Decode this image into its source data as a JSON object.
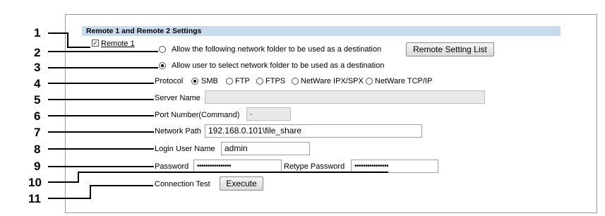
{
  "section": {
    "title": "Remote 1 and Remote 2 Settings"
  },
  "remote1": {
    "label": "Remote 1",
    "checked": true
  },
  "destination": {
    "option_following": "Allow the following network folder to be used as a destination",
    "option_user_select": "Allow user to select network folder to be used as a destination",
    "remote_setting_list_button": "Remote Setting List"
  },
  "protocol": {
    "label": "Protocol",
    "options": [
      "SMB",
      "FTP",
      "FTPS",
      "NetWare IPX/SPX",
      "NetWare TCP/IP"
    ],
    "selected": "SMB"
  },
  "server_name": {
    "label": "Server Name",
    "value": ""
  },
  "port": {
    "label": "Port Number(Command)",
    "value": "-"
  },
  "network_path": {
    "label": "Network Path",
    "value": "192.168.0.101\\file_share"
  },
  "login_user": {
    "label": "Login User Name",
    "value": "admin"
  },
  "password": {
    "label": "Password",
    "value": "••••••••••••••••",
    "retype_label": "Retype Password",
    "retype_value": "••••••••••••••••"
  },
  "connection_test": {
    "label": "Connection Test",
    "button": "Execute"
  },
  "callouts": [
    "1",
    "2",
    "3",
    "4",
    "5",
    "6",
    "7",
    "8",
    "9",
    "10",
    "11"
  ]
}
